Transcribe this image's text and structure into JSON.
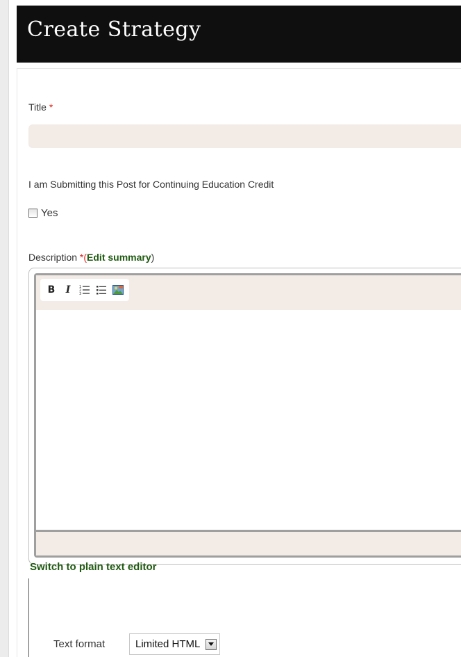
{
  "header": {
    "title": "Create Strategy"
  },
  "form": {
    "title_field": {
      "label": "Title",
      "required_marker": "*",
      "value": ""
    },
    "continuing_education": {
      "label": "I am Submitting this Post for Continuing Education Credit",
      "option_label": "Yes",
      "checked": false
    },
    "description": {
      "label": "Description",
      "required_marker": "*",
      "open_paren": "(",
      "edit_summary_link": "Edit summary",
      "close_paren": ")",
      "toolbar": [
        {
          "name": "bold",
          "glyph": "B"
        },
        {
          "name": "italic",
          "glyph": "I"
        },
        {
          "name": "numbered-list",
          "icon": "numbered-list-icon"
        },
        {
          "name": "bulleted-list",
          "icon": "bulleted-list-icon"
        },
        {
          "name": "image",
          "icon": "image-icon"
        }
      ]
    },
    "switch_editor_link": "Switch to plain text editor",
    "text_format": {
      "label": "Text format",
      "selected": "Limited HTML"
    }
  },
  "colors": {
    "header_bg": "#0f0f0f",
    "input_bg": "#f2ebe6",
    "link_green": "#1f5a10",
    "required_red": "#e0261d"
  }
}
